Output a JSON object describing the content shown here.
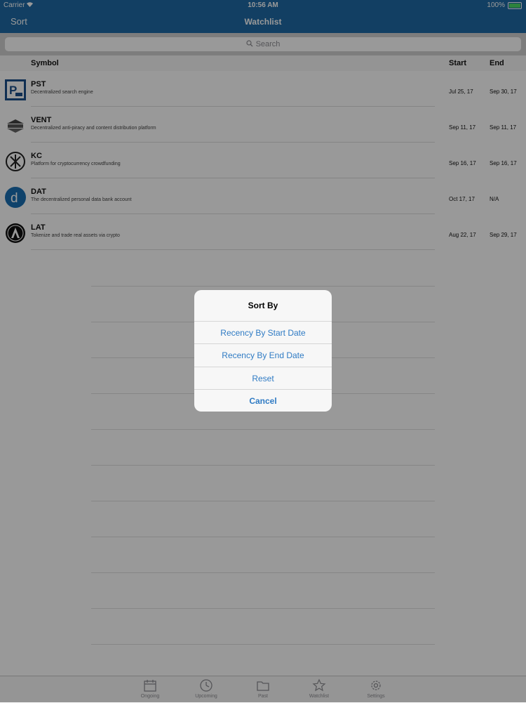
{
  "status_bar": {
    "carrier": "Carrier",
    "time": "10:56 AM",
    "battery": "100%"
  },
  "nav": {
    "sort_label": "Sort",
    "title": "Watchlist"
  },
  "search": {
    "placeholder": "Search"
  },
  "columns": {
    "symbol": "Symbol",
    "start": "Start",
    "end": "End"
  },
  "rows": [
    {
      "symbol": "PST",
      "description": "Decentralized search engine",
      "start": "Jul 25, 17",
      "end": "Sep 30, 17",
      "icon": "pst-logo-icon"
    },
    {
      "symbol": "VENT",
      "description": "Decentralized anti-piracy and content distribution platform",
      "start": "Sep 11, 17",
      "end": "Sep 11, 17",
      "icon": "vent-logo-icon"
    },
    {
      "symbol": "KC",
      "description": "Platform for cryptocurrency crowdfunding",
      "start": "Sep 16, 17",
      "end": "Sep 16, 17",
      "icon": "kc-logo-icon"
    },
    {
      "symbol": "DAT",
      "description": "The decentralized personal data bank account",
      "start": "Oct 17, 17",
      "end": "N/A",
      "icon": "dat-logo-icon"
    },
    {
      "symbol": "LAT",
      "description": "Tokenize and trade real assets via crypto",
      "start": "Aug 22, 17",
      "end": "Sep 29, 17",
      "icon": "lat-logo-icon"
    }
  ],
  "dialog": {
    "title": "Sort By",
    "options": [
      "Recency By Start Date",
      "Recency By End Date",
      "Reset"
    ],
    "cancel": "Cancel"
  },
  "tabs": [
    {
      "label": "Ongoing",
      "icon": "calendar-icon"
    },
    {
      "label": "Upcoming",
      "icon": "clock-icon"
    },
    {
      "label": "Past",
      "icon": "folder-icon"
    },
    {
      "label": "Watchlist",
      "icon": "star-icon"
    },
    {
      "label": "Settings",
      "icon": "gear-icon"
    }
  ],
  "colors": {
    "nav": "#1f6aa5",
    "accent": "#2f7bc4",
    "overlay": "rgba(0,0,0,0.4)"
  }
}
